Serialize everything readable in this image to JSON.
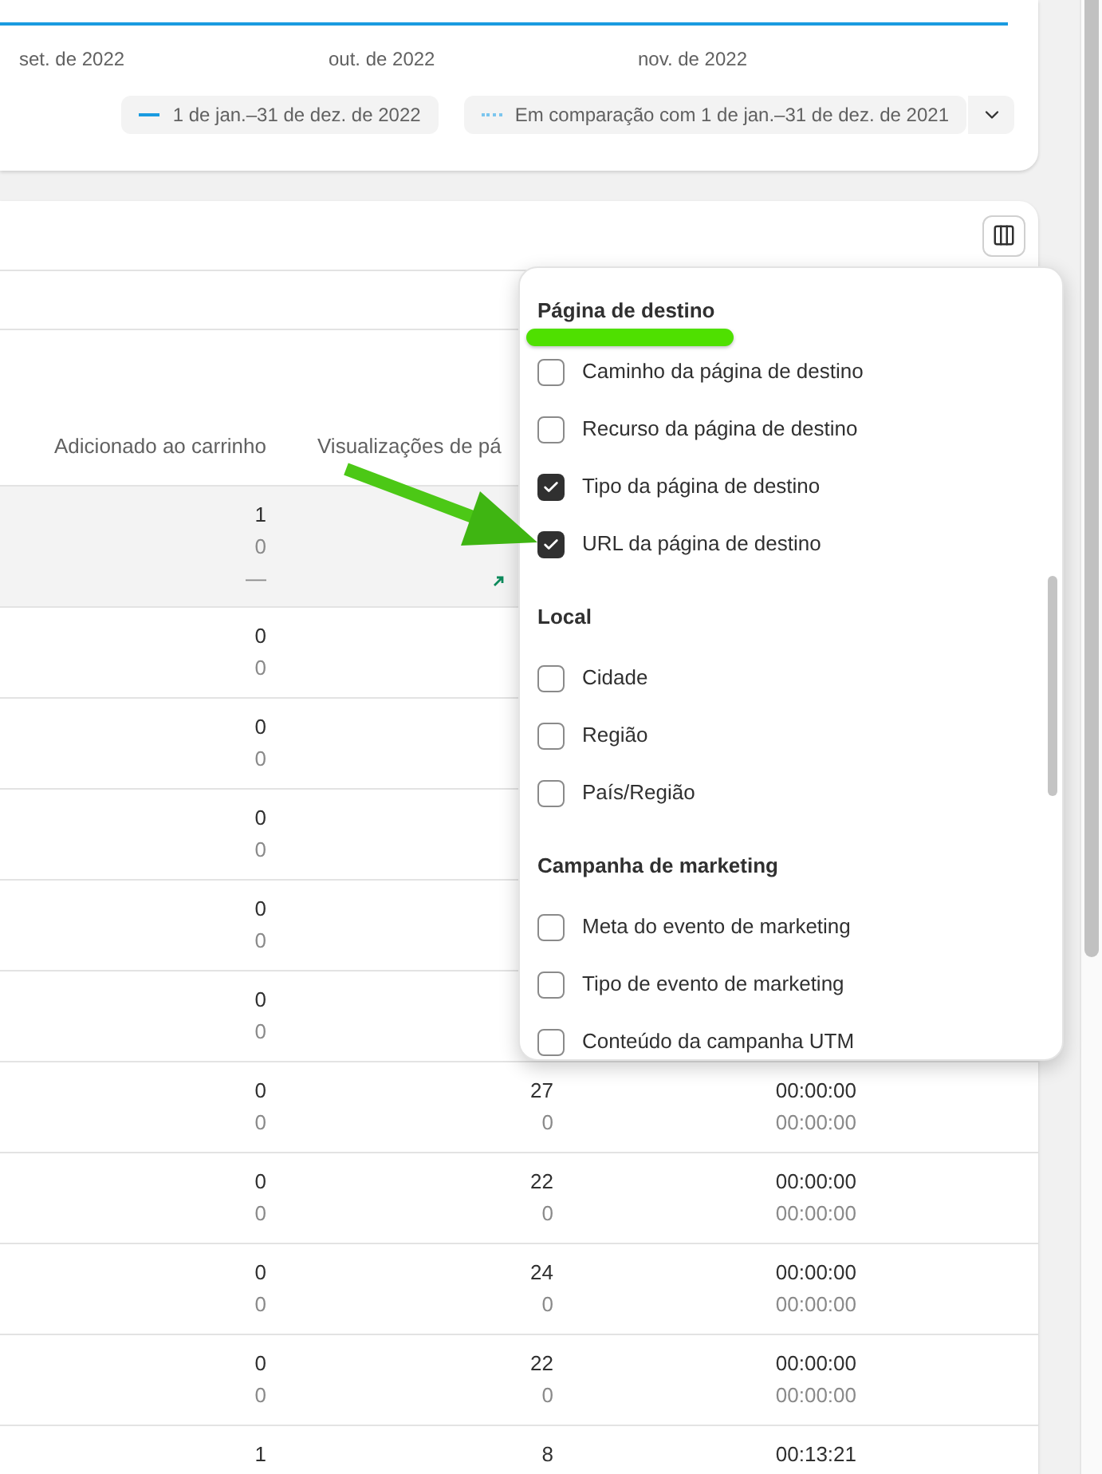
{
  "chart": {
    "x_labels": [
      "set. de 2022",
      "out. de 2022",
      "nov. de 2022"
    ],
    "legend": [
      {
        "label": "1 de jan.–31 de dez. de 2022",
        "kind": "solid"
      },
      {
        "label": "Em comparação com 1 de jan.–31 de dez. de 2021",
        "kind": "dotted"
      }
    ]
  },
  "table": {
    "columns": [
      "Adicionado ao carrinho",
      "Visualizações de pá"
    ],
    "summary": {
      "added": [
        "1",
        "0",
        "—"
      ],
      "views_trend_up": true
    },
    "rows": [
      {
        "added": [
          "0",
          "0"
        ]
      },
      {
        "added": [
          "0",
          "0"
        ]
      },
      {
        "added": [
          "0",
          "0"
        ]
      },
      {
        "added": [
          "0",
          "0"
        ]
      },
      {
        "added": [
          "0",
          "0"
        ]
      },
      {
        "added": [
          "0",
          "0"
        ],
        "views": [
          "27",
          "0"
        ],
        "time": [
          "00:00:00",
          "00:00:00"
        ]
      },
      {
        "added": [
          "0",
          "0"
        ],
        "views": [
          "22",
          "0"
        ],
        "time": [
          "00:00:00",
          "00:00:00"
        ]
      },
      {
        "added": [
          "0",
          "0"
        ],
        "views": [
          "24",
          "0"
        ],
        "time": [
          "00:00:00",
          "00:00:00"
        ]
      },
      {
        "added": [
          "0",
          "0"
        ],
        "views": [
          "22",
          "0"
        ],
        "time": [
          "00:00:00",
          "00:00:00"
        ]
      },
      {
        "added": [
          "1"
        ],
        "views": [
          "8"
        ],
        "time": [
          "00:13:21"
        ]
      }
    ]
  },
  "column_menu": {
    "sections": [
      {
        "title": "Página de destino",
        "items": [
          {
            "label": "Caminho da página de destino",
            "checked": false
          },
          {
            "label": "Recurso da página de destino",
            "checked": false
          },
          {
            "label": "Tipo da página de destino",
            "checked": true
          },
          {
            "label": "URL da página de destino",
            "checked": true
          }
        ]
      },
      {
        "title": "Local",
        "items": [
          {
            "label": "Cidade",
            "checked": false
          },
          {
            "label": "Região",
            "checked": false
          },
          {
            "label": "País/Região",
            "checked": false
          }
        ]
      },
      {
        "title": "Campanha de marketing",
        "items": [
          {
            "label": "Meta do evento de marketing",
            "checked": false
          },
          {
            "label": "Tipo de evento de marketing",
            "checked": false
          },
          {
            "label": "Conteúdo da campanha UTM",
            "checked": false
          }
        ]
      }
    ]
  }
}
